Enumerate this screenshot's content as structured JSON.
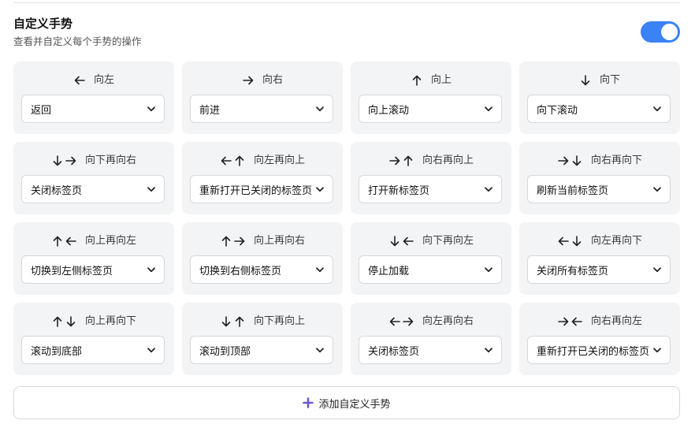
{
  "header": {
    "title": "自定义手势",
    "subtitle": "查看并自定义每个手势的操作",
    "toggle_enabled": true
  },
  "colors": {
    "accent": "#3b82f6",
    "card_bg": "#f3f4f6",
    "plus": "#6d5bd0"
  },
  "gestures": [
    {
      "dirs": [
        "left"
      ],
      "label": "向左",
      "action": "返回"
    },
    {
      "dirs": [
        "right"
      ],
      "label": "向右",
      "action": "前进"
    },
    {
      "dirs": [
        "up"
      ],
      "label": "向上",
      "action": "向上滚动"
    },
    {
      "dirs": [
        "down"
      ],
      "label": "向下",
      "action": "向下滚动"
    },
    {
      "dirs": [
        "down",
        "right"
      ],
      "label": "向下再向右",
      "action": "关闭标签页"
    },
    {
      "dirs": [
        "left",
        "up"
      ],
      "label": "向左再向上",
      "action": "重新打开已关闭的标签页"
    },
    {
      "dirs": [
        "right",
        "up"
      ],
      "label": "向右再向上",
      "action": "打开新标签页"
    },
    {
      "dirs": [
        "right",
        "down"
      ],
      "label": "向右再向下",
      "action": "刷新当前标签页"
    },
    {
      "dirs": [
        "up",
        "left"
      ],
      "label": "向上再向左",
      "action": "切换到左侧标签页"
    },
    {
      "dirs": [
        "up",
        "right"
      ],
      "label": "向上再向右",
      "action": "切换到右侧标签页"
    },
    {
      "dirs": [
        "down",
        "left"
      ],
      "label": "向下再向左",
      "action": "停止加载"
    },
    {
      "dirs": [
        "left",
        "down"
      ],
      "label": "向左再向下",
      "action": "关闭所有标签页"
    },
    {
      "dirs": [
        "up",
        "down"
      ],
      "label": "向上再向下",
      "action": "滚动到底部"
    },
    {
      "dirs": [
        "down",
        "up"
      ],
      "label": "向下再向上",
      "action": "滚动到顶部"
    },
    {
      "dirs": [
        "left",
        "right"
      ],
      "label": "向左再向右",
      "action": "关闭标签页"
    },
    {
      "dirs": [
        "right",
        "left"
      ],
      "label": "向右再向左",
      "action": "重新打开已关闭的标签页"
    }
  ],
  "add_button": {
    "label": "添加自定义手势",
    "icon": "plus-icon"
  }
}
